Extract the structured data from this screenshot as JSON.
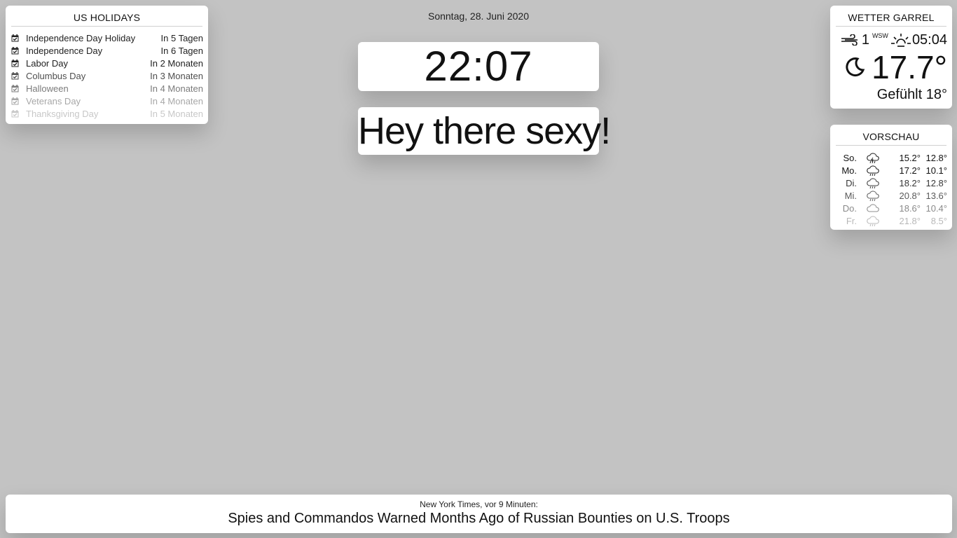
{
  "calendar": {
    "header": "US HOLIDAYS",
    "events": [
      {
        "title": "Independence Day Holiday",
        "time": "In 5 Tagen",
        "opacity": 1.0
      },
      {
        "title": "Independence Day",
        "time": "In 6 Tagen",
        "opacity": 1.0
      },
      {
        "title": "Labor Day",
        "time": "In 2 Monaten",
        "opacity": 1.0
      },
      {
        "title": "Columbus Day",
        "time": "In 3 Monaten",
        "opacity": 0.8
      },
      {
        "title": "Halloween",
        "time": "In 4 Monaten",
        "opacity": 0.6
      },
      {
        "title": "Veterans Day",
        "time": "In 4 Monaten",
        "opacity": 0.4
      },
      {
        "title": "Thanksgiving Day",
        "time": "In 5 Monaten",
        "opacity": 0.25
      }
    ],
    "icon": "calendar-check-icon"
  },
  "clock": {
    "date": "Sonntag, 28. Juni 2020",
    "time": "22:07"
  },
  "compliment": {
    "text": "Hey there sexy!"
  },
  "weather": {
    "header": "WETTER GARREL",
    "wind_icon": "wind-icon",
    "wind_speed": "1",
    "wind_direction": "WSW",
    "sunrise_icon": "sunrise-icon",
    "sunrise_time": "05:04",
    "condition_icon": "night-clear-moon-icon",
    "temperature": "17.7°",
    "feels_like": "Gefühlt 18°"
  },
  "forecast": {
    "header": "VORSCHAU",
    "days": [
      {
        "day": "So.",
        "icon": "thunderstorm-rain-icon",
        "max": "15.2°",
        "min": "12.8°",
        "opacity": 1.0
      },
      {
        "day": "Mo.",
        "icon": "rain-icon",
        "max": "17.2°",
        "min": "10.1°",
        "opacity": 1.0
      },
      {
        "day": "Di.",
        "icon": "rain-icon",
        "max": "18.2°",
        "min": "12.8°",
        "opacity": 0.85
      },
      {
        "day": "Mi.",
        "icon": "rain-icon",
        "max": "20.8°",
        "min": "13.6°",
        "opacity": 0.7
      },
      {
        "day": "Do.",
        "icon": "cloudy-icon",
        "max": "18.6°",
        "min": "10.4°",
        "opacity": 0.5
      },
      {
        "day": "Fr.",
        "icon": "rain-icon",
        "max": "21.8°",
        "min": "8.5°",
        "opacity": 0.3
      }
    ]
  },
  "news": {
    "source": "New York Times, vor 9 Minuten:",
    "headline": "Spies and Commandos Warned Months Ago of Russian Bounties on U.S. Troops"
  }
}
